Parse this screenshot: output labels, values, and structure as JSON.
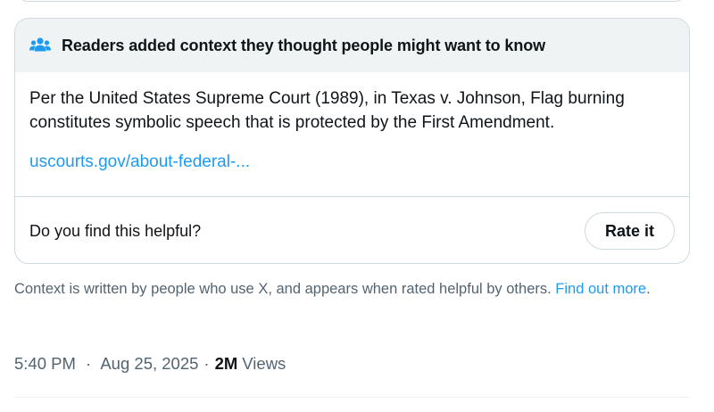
{
  "community_note": {
    "header_icon": "people-icon",
    "title": "Readers added context they thought people might want to know",
    "body": "Per the United States Supreme Court (1989), in Texas v. Johnson, Flag burning constitutes symbolic speech that is protected by the First Amendment.",
    "source_link": "uscourts.gov/about-federal-...",
    "helpful_question": "Do you find this helpful?",
    "rate_button": "Rate it"
  },
  "context_disclaimer": {
    "text": "Context is written by people who use X, and appears when rated helpful by others.",
    "link": "Find out more",
    "suffix": "."
  },
  "post_meta": {
    "time": "5:40 PM",
    "separator": "·",
    "date": "Aug 25, 2025",
    "views_count": "2M",
    "views_label": "Views"
  },
  "colors": {
    "link": "#1d9bf0",
    "border": "#cfd9de",
    "header_bg": "#eff3f4",
    "secondary_text": "#536471"
  }
}
